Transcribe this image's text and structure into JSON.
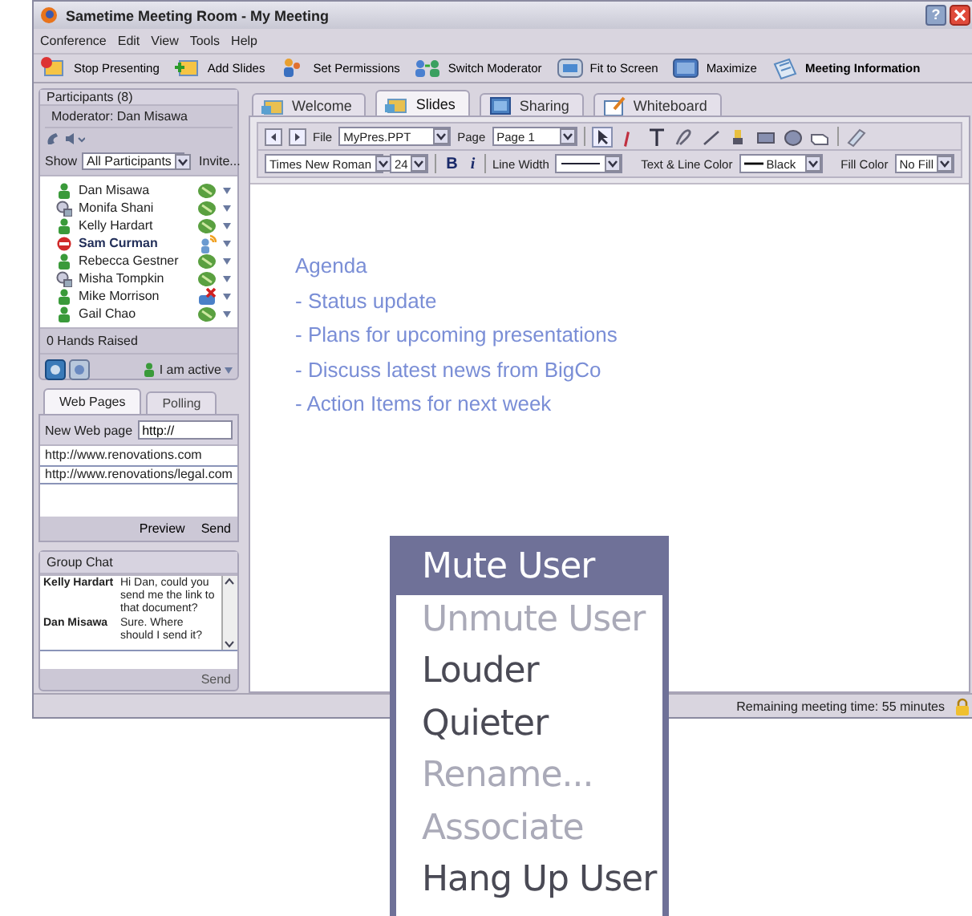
{
  "window": {
    "title": "Sametime Meeting Room - My Meeting",
    "help_button": "?"
  },
  "menu_bar": [
    "Conference",
    "Edit",
    "View",
    "Tools",
    "Help"
  ],
  "toolbar": [
    "Stop Presenting",
    "Add Slides",
    "Set Permissions",
    "Switch Moderator",
    "Fit to Screen",
    "Maximize",
    "Meeting Information"
  ],
  "participants": {
    "title": "Participants (8)",
    "moderator": "Moderator:  Dan Misawa",
    "show_label": "Show",
    "show_value": "All Participants",
    "invite": "Invite...",
    "people": [
      {
        "name": "Dan Misawa",
        "kind": "active",
        "speaking": false,
        "muted": false,
        "highlighted": false
      },
      {
        "name": "Monifa Shani",
        "kind": "idle",
        "speaking": false,
        "muted": false,
        "highlighted": false
      },
      {
        "name": "Kelly Hardart",
        "kind": "active",
        "speaking": false,
        "muted": false,
        "highlighted": false
      },
      {
        "name": "Sam Curman",
        "kind": "busy",
        "speaking": true,
        "muted": false,
        "highlighted": true
      },
      {
        "name": "Rebecca Gestner",
        "kind": "active",
        "speaking": false,
        "muted": false,
        "highlighted": false
      },
      {
        "name": "Misha Tompkin",
        "kind": "idle",
        "speaking": false,
        "muted": false,
        "highlighted": false
      },
      {
        "name": "Mike Morrison",
        "kind": "active",
        "speaking": false,
        "muted": true,
        "highlighted": false
      },
      {
        "name": "Gail Chao",
        "kind": "active",
        "speaking": false,
        "muted": false,
        "highlighted": false
      }
    ],
    "hands": "0 Hands Raised",
    "my_status": "I am active"
  },
  "web_panel": {
    "tabs": [
      {
        "label": "Web Pages",
        "selected": true
      },
      {
        "label": "Polling",
        "selected": false
      }
    ],
    "new_label": "New Web page",
    "url_value": "http://",
    "pages": [
      {
        "url": "http://www.renovations.com",
        "selected": false
      },
      {
        "url": "http://www.renovations/legal.com",
        "selected": true
      }
    ],
    "buttons": [
      "Preview",
      "Send"
    ]
  },
  "chat": {
    "title": "Group Chat",
    "messages": [
      {
        "sender": "Kelly Hardart",
        "text": "Hi Dan, could you send me the link to that document?"
      },
      {
        "sender": "Dan Misawa",
        "text": "Sure. Where should I send it?"
      }
    ],
    "send": "Send"
  },
  "content_tabs": [
    {
      "label": "Welcome",
      "selected": false
    },
    {
      "label": "Slides",
      "selected": true
    },
    {
      "label": "Sharing",
      "selected": false
    },
    {
      "label": "Whiteboard",
      "selected": false
    }
  ],
  "slide_toolbar": {
    "file_label": "File",
    "file_value": "MyPres.PPT",
    "page_label": "Page",
    "page_value": "Page 1",
    "font": "Times New Roman",
    "size": "24",
    "bold": "B",
    "italic": "i",
    "line_width_label": "Line Width",
    "color_label": "Text & Line Color",
    "color_value": "Black",
    "fill_label": "Fill Color",
    "fill_value": "No Fill"
  },
  "slide": {
    "lines": [
      "Agenda",
      "- Status update",
      "- Plans for upcoming presentations",
      "- Discuss latest news from BigCo",
      "- Action Items for next week"
    ]
  },
  "status_bar": "Remaining meeting time: 55 minutes",
  "context_menu": [
    {
      "label": "Mute User",
      "selected": true,
      "disabled": false
    },
    {
      "label": "Unmute User",
      "selected": false,
      "disabled": true
    },
    {
      "label": "Louder",
      "selected": false,
      "disabled": false
    },
    {
      "label": "Quieter",
      "selected": false,
      "disabled": false
    },
    {
      "label": "Rename...",
      "selected": false,
      "disabled": true
    },
    {
      "label": "Associate",
      "selected": false,
      "disabled": true
    },
    {
      "label": "Hang Up User",
      "selected": false,
      "disabled": false
    }
  ]
}
